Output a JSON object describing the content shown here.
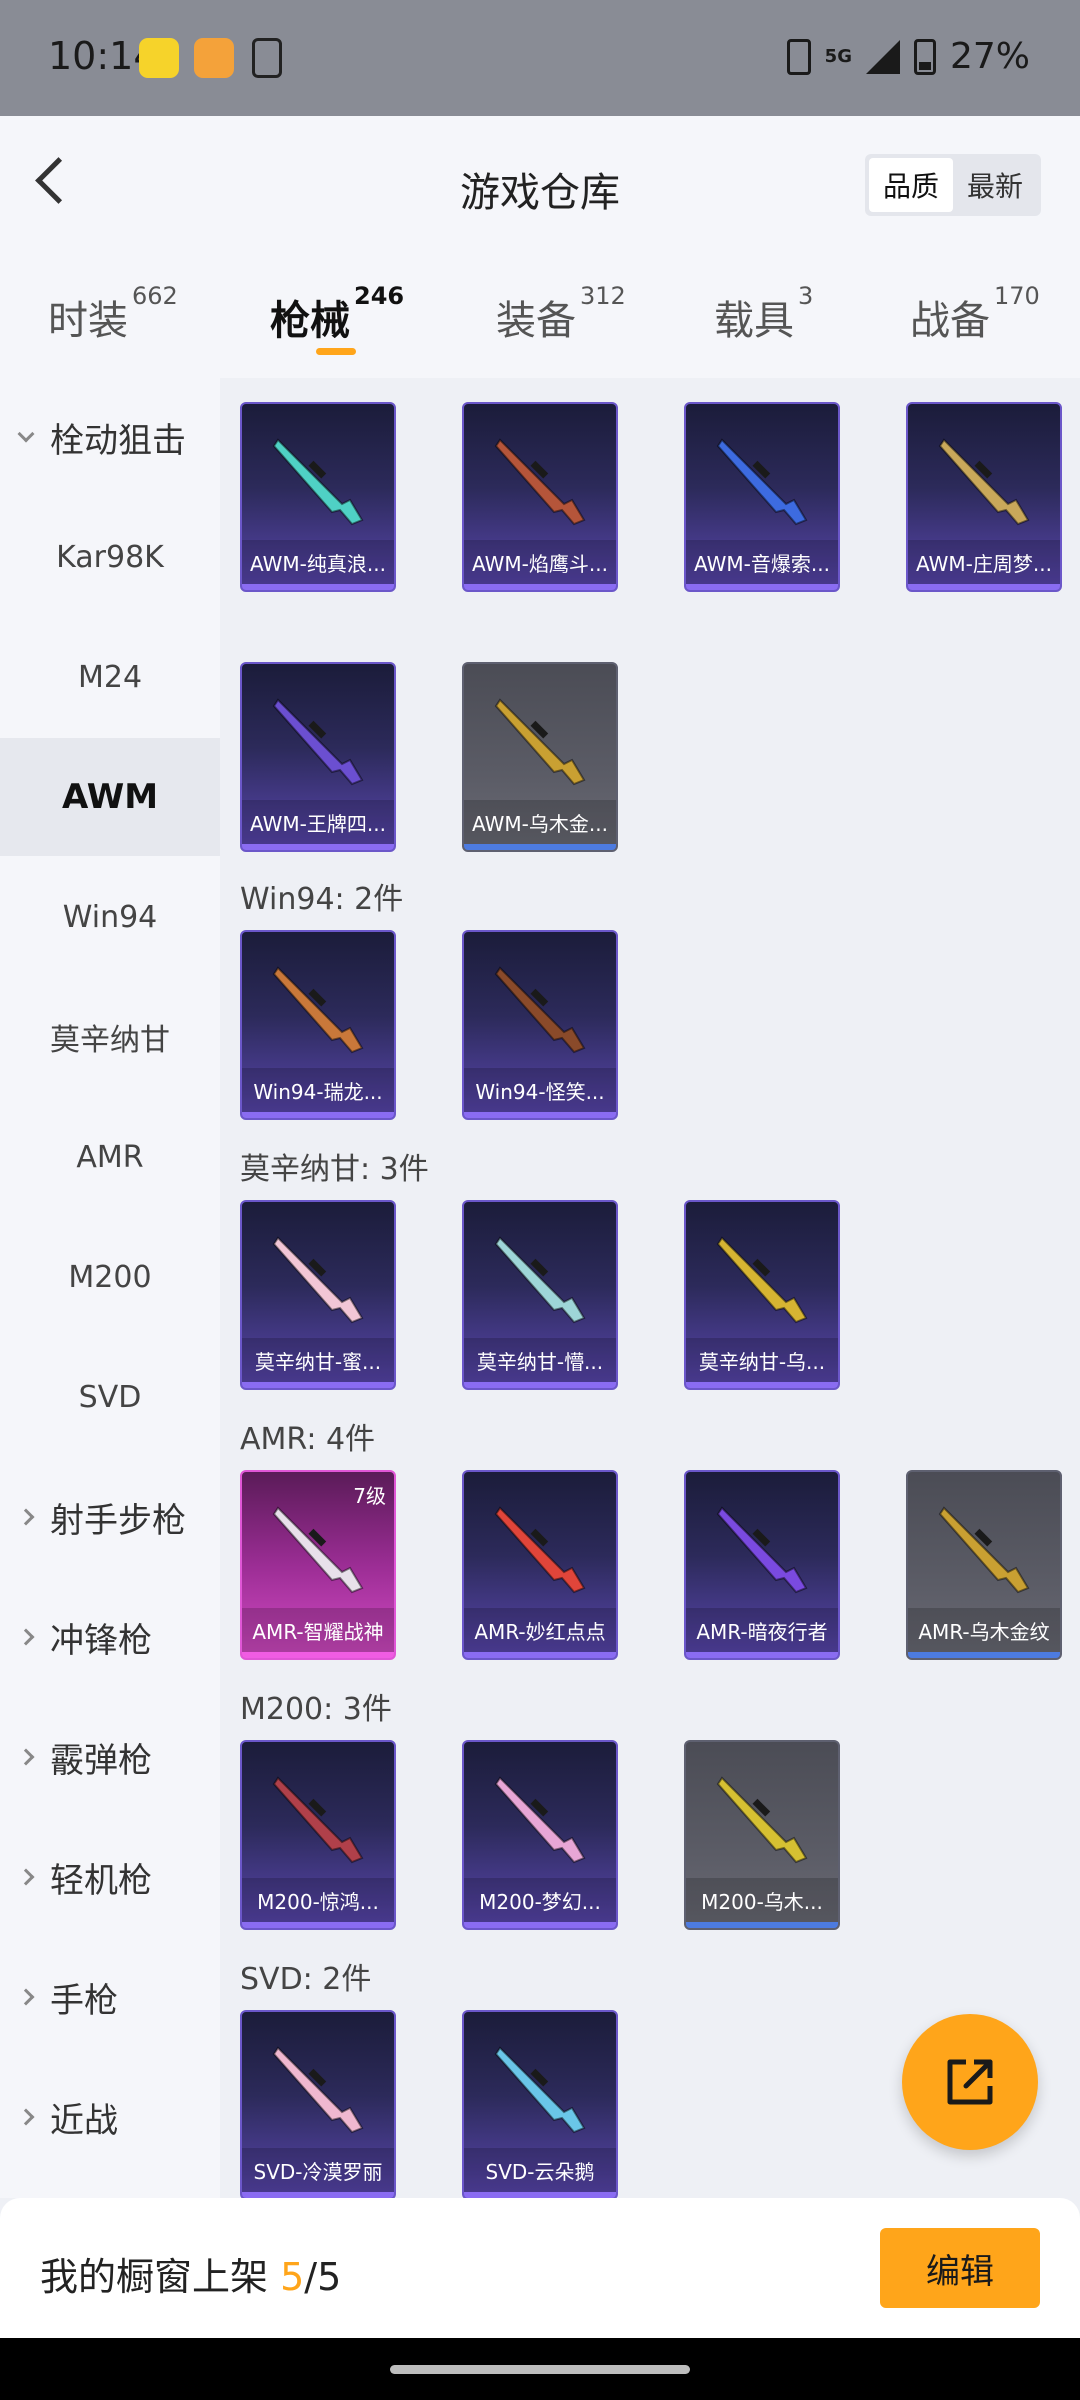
{
  "status": {
    "time": "10:14",
    "network": "5G",
    "battery": "27%"
  },
  "header": {
    "title": "游戏仓库",
    "sort_options": [
      "品质",
      "最新"
    ],
    "sort_selected": "品质"
  },
  "tabs": [
    {
      "label": "时装",
      "count": "662"
    },
    {
      "label": "枪械",
      "count": "246",
      "active": true
    },
    {
      "label": "装备",
      "count": "312"
    },
    {
      "label": "载具",
      "count": "3"
    },
    {
      "label": "战备",
      "count": "170"
    }
  ],
  "sidebar": {
    "items": [
      {
        "label": "栓动狙击",
        "type": "group",
        "open": true
      },
      {
        "label": "Kar98K"
      },
      {
        "label": "M24"
      },
      {
        "label": "AWM",
        "active": true
      },
      {
        "label": "Win94"
      },
      {
        "label": "莫辛纳甘"
      },
      {
        "label": "AMR"
      },
      {
        "label": "M200"
      },
      {
        "label": "SVD"
      },
      {
        "label": "射手步枪",
        "type": "group"
      },
      {
        "label": "冲锋枪",
        "type": "group"
      },
      {
        "label": "霰弹枪",
        "type": "group"
      },
      {
        "label": "轻机枪",
        "type": "group"
      },
      {
        "label": "手枪",
        "type": "group"
      },
      {
        "label": "近战",
        "type": "group"
      }
    ]
  },
  "sections": [
    {
      "label": "",
      "items": [
        {
          "name": "AWM-纯真浪...",
          "rarity": "purple",
          "gun_color": "#4fd1c5"
        },
        {
          "name": "AWM-焰鹰斗...",
          "rarity": "purple",
          "gun_color": "#b5553a"
        },
        {
          "name": "AWM-音爆索...",
          "rarity": "purple",
          "gun_color": "#3d6be0"
        },
        {
          "name": "AWM-庄周梦...",
          "rarity": "purple",
          "gun_color": "#c9a85a"
        },
        {
          "name": "AWM-王牌四...",
          "rarity": "purple",
          "gun_color": "#6b4fd1"
        },
        {
          "name": "AWM-乌木金...",
          "rarity": "gray",
          "gun_color": "#c9a032"
        }
      ]
    },
    {
      "label": "Win94: 2件",
      "items": [
        {
          "name": "Win94-瑞龙...",
          "rarity": "purple",
          "gun_color": "#c9783a"
        },
        {
          "name": "Win94-怪笑...",
          "rarity": "purple",
          "gun_color": "#8a4a2a"
        }
      ]
    },
    {
      "label": "莫辛纳甘: 3件",
      "items": [
        {
          "name": "莫辛纳甘-蜜...",
          "rarity": "purple",
          "gun_color": "#f2c6d6"
        },
        {
          "name": "莫辛纳甘-懵...",
          "rarity": "purple",
          "gun_color": "#9ed6d8"
        },
        {
          "name": "莫辛纳甘-乌...",
          "rarity": "purple",
          "gun_color": "#d6b432"
        }
      ]
    },
    {
      "label": "AMR: 4件",
      "items": [
        {
          "name": "AMR-智耀战神",
          "rarity": "pink",
          "gun_color": "#e8e0ea",
          "level": "7级"
        },
        {
          "name": "AMR-妙红点点",
          "rarity": "purple",
          "gun_color": "#e0453a"
        },
        {
          "name": "AMR-暗夜行者",
          "rarity": "purple",
          "gun_color": "#7a4ae0"
        },
        {
          "name": "AMR-乌木金纹",
          "rarity": "gray",
          "gun_color": "#c9a032"
        }
      ]
    },
    {
      "label": "M200: 3件",
      "items": [
        {
          "name": "M200-惊鸿...",
          "rarity": "purple",
          "gun_color": "#b0404a"
        },
        {
          "name": "M200-梦幻...",
          "rarity": "purple",
          "gun_color": "#e8a6d6"
        },
        {
          "name": "M200-乌木...",
          "rarity": "gray",
          "gun_color": "#d6c032"
        }
      ]
    },
    {
      "label": "SVD: 2件",
      "items": [
        {
          "name": "SVD-冷漠罗丽",
          "rarity": "purple",
          "gun_color": "#f0b8d0"
        },
        {
          "name": "SVD-云朵鹅",
          "rarity": "purple",
          "gun_color": "#6ac6e8"
        }
      ]
    }
  ],
  "fab": {
    "icon": "share-icon"
  },
  "bottom": {
    "label": "我的橱窗上架 ",
    "count": "5",
    "total": "/5",
    "edit_label": "编辑"
  }
}
